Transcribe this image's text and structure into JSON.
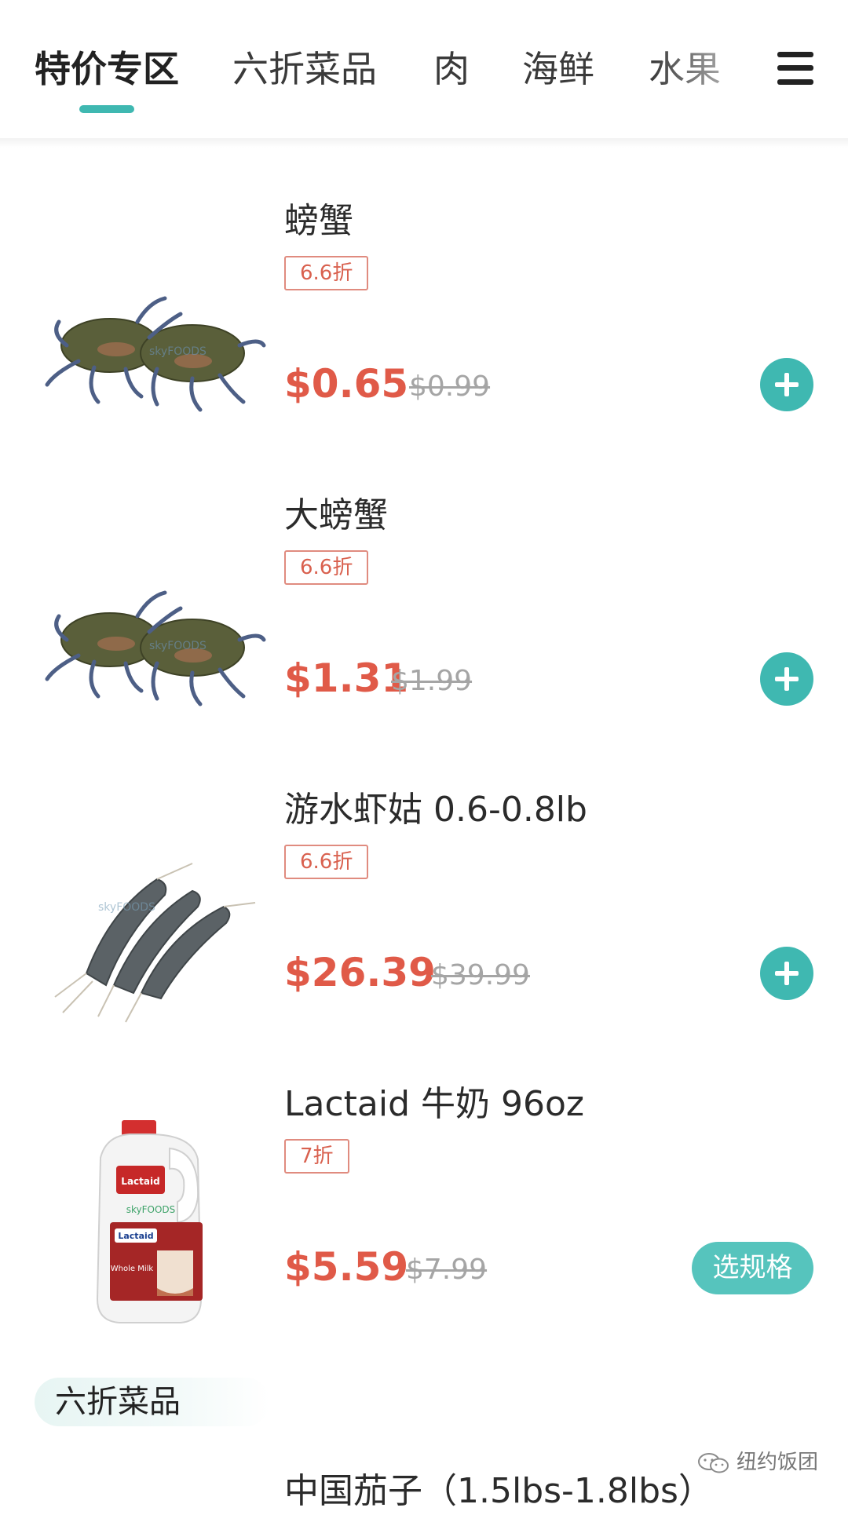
{
  "tabs": [
    {
      "label": "特价专区",
      "active": true
    },
    {
      "label": "六折菜品",
      "active": false
    },
    {
      "label": "肉",
      "active": false
    },
    {
      "label": "海鲜",
      "active": false
    },
    {
      "label": "水果",
      "active": false
    }
  ],
  "menu_icon": "hamburger-menu-icon",
  "products": [
    {
      "name": "螃蟹",
      "badge": "6.6折",
      "price": "$0.65",
      "old_price": "$0.99",
      "action": "add",
      "image": "crabs"
    },
    {
      "name": "大螃蟹",
      "badge": "6.6折",
      "price": "$1.31",
      "old_price": "$1.99",
      "action": "add",
      "image": "crabs"
    },
    {
      "name": "游水虾姑 0.6-0.8lb",
      "badge": "6.6折",
      "price": "$26.39",
      "old_price": "$39.99",
      "action": "add",
      "image": "mantis-shrimp"
    },
    {
      "name": "Lactaid 牛奶 96oz",
      "badge": "7折",
      "price": "$5.59",
      "old_price": "$7.99",
      "action": "spec",
      "action_label": "选规格",
      "image": "milk-jug"
    }
  ],
  "milk_jug": {
    "brand": "Lactaid",
    "variant": "Whole Milk",
    "store": "skyFOODS"
  },
  "image_watermark": "skyFOODS",
  "section": {
    "title": "六折菜品"
  },
  "next_product": {
    "name": "中国茄子（1.5lbs-1.8lbs）"
  },
  "watermark": {
    "text": "纽约饭团"
  },
  "colors": {
    "accent": "#3fb8b1",
    "price": "#e05a48",
    "badge": "#d9614f",
    "old_price": "#a5a5a5"
  }
}
